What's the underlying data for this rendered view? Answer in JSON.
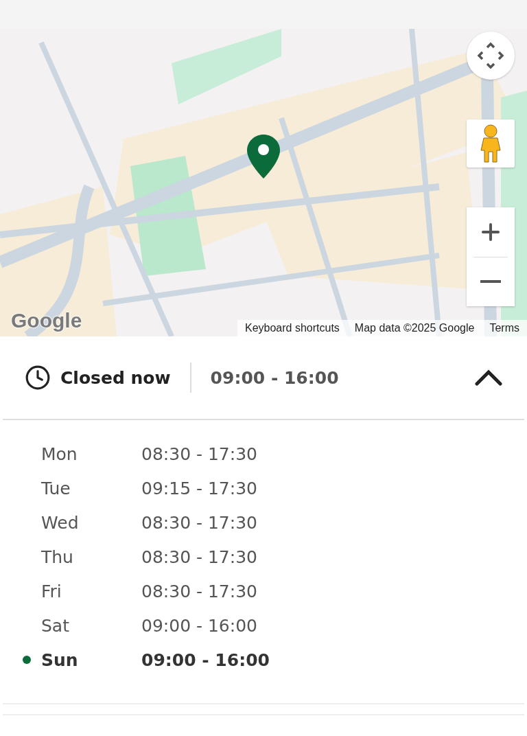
{
  "map": {
    "kind": "picture",
    "logo": "Google",
    "attribution": [
      {
        "label": "Keyboard shortcuts"
      },
      {
        "label": "Map data ©2025 Google"
      },
      {
        "label": "Terms"
      }
    ]
  },
  "hours": {
    "status": "Closed now",
    "today_hours": "09:00 - 16:00",
    "expanded": true,
    "days": [
      {
        "day": "Mon",
        "hours": "08:30 - 17:30",
        "selected": false
      },
      {
        "day": "Tue",
        "hours": "09:15 - 17:30",
        "selected": false
      },
      {
        "day": "Wed",
        "hours": "08:30 - 17:30",
        "selected": false
      },
      {
        "day": "Thu",
        "hours": "08:30 - 17:30",
        "selected": false
      },
      {
        "day": "Fri",
        "hours": "08:30 - 17:30",
        "selected": false
      },
      {
        "day": "Sat",
        "hours": "09:00 - 16:00",
        "selected": false
      },
      {
        "day": "Sun",
        "hours": "09:00 - 16:00",
        "selected": true
      }
    ]
  }
}
